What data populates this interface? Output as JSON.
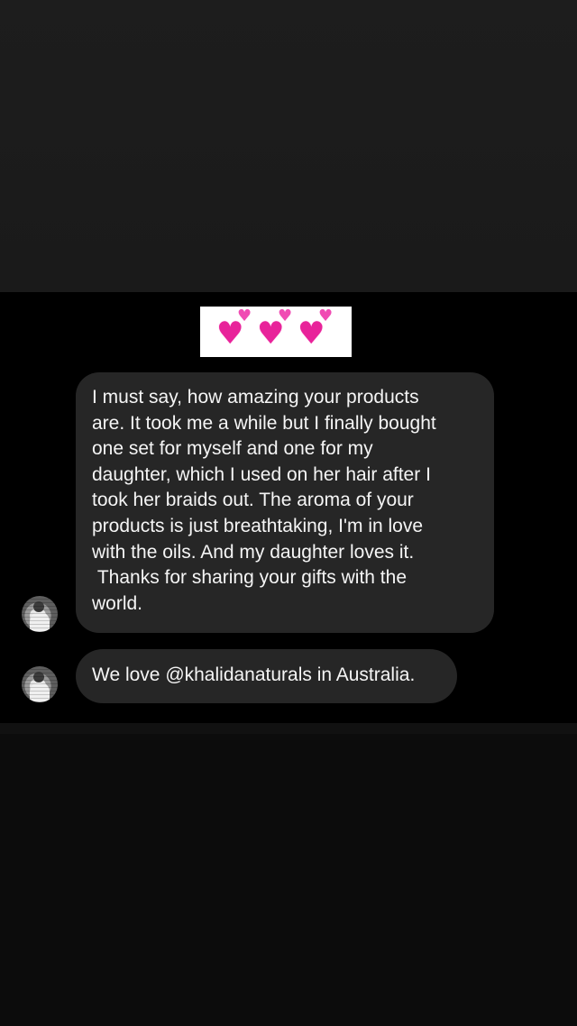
{
  "sticker": {
    "icons": [
      "pink-heart-icon",
      "pink-heart-icon",
      "pink-heart-icon"
    ],
    "heart_color": "#e8239a"
  },
  "messages": [
    {
      "text": "I must say, how amazing your products\nare. It took me a while but I finally bought\none set for myself and one for my\ndaughter, which I used on her hair after I\ntook her braids out. The aroma of your\nproducts is just breathtaking, I'm in love\nwith the oils. And my daughter loves it.\n Thanks for sharing your gifts with the\nworld."
    },
    {
      "text": "We love @khalidanaturals in Australia."
    }
  ],
  "colors": {
    "bubble": "#262626",
    "chat_background": "#000000",
    "outer_background": "#1c1c1c",
    "text": "#f5f5f5"
  }
}
